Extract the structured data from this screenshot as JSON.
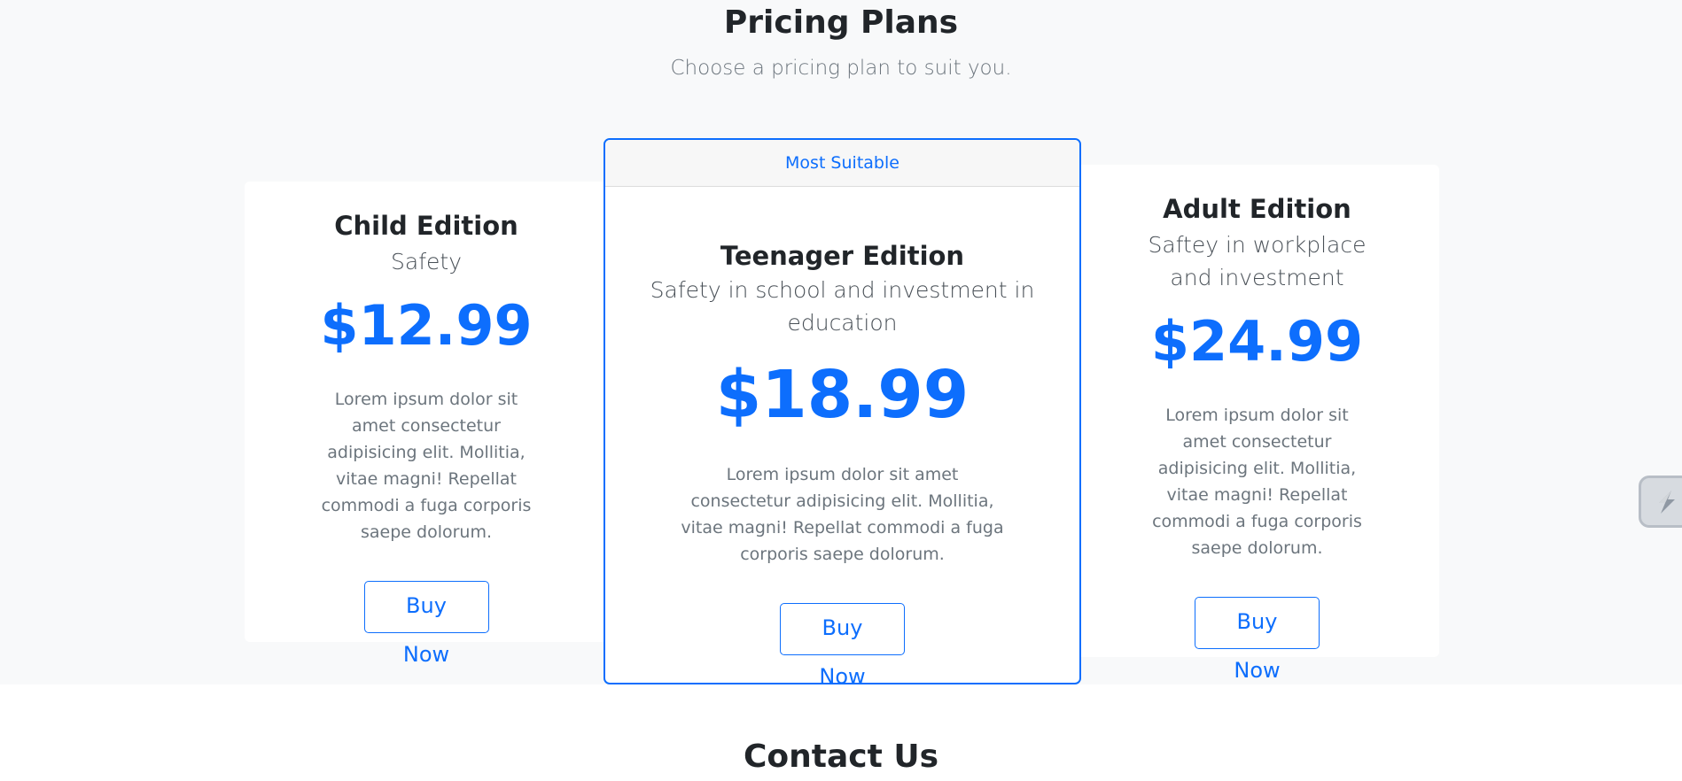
{
  "pricing": {
    "title": "Pricing Plans",
    "subtitle": "Choose a pricing plan to suit you.",
    "plans": [
      {
        "name": "Child Edition",
        "tagline": "Safety",
        "price": "$12.99",
        "description": "Lorem ipsum dolor sit amet consectetur adipisicing elit. Mollitia, vitae magni! Repellat commodi a fuga corporis saepe dolorum.",
        "button": "Buy Now"
      },
      {
        "badge": "Most Suitable",
        "name": "Teenager Edition",
        "tagline": "Safety in school and investment in education",
        "price": "$18.99",
        "description": "Lorem ipsum dolor sit amet consectetur adipisicing elit. Mollitia, vitae magni! Repellat commodi a fuga corporis saepe dolorum.",
        "button": "Buy Now"
      },
      {
        "name": "Adult Edition",
        "tagline": "Saftey in workplace and investment",
        "price": "$24.99",
        "description": "Lorem ipsum dolor sit amet consectetur adipisicing elit. Mollitia, vitae magni! Repellat commodi a fuga corporis saepe dolorum.",
        "button": "Buy Now"
      }
    ]
  },
  "contact": {
    "title": "Contact Us"
  },
  "widget": {
    "icon": "lightning-logo-icon"
  },
  "colors": {
    "accent": "#0d6efd",
    "section_bg": "#f8f9fa"
  }
}
